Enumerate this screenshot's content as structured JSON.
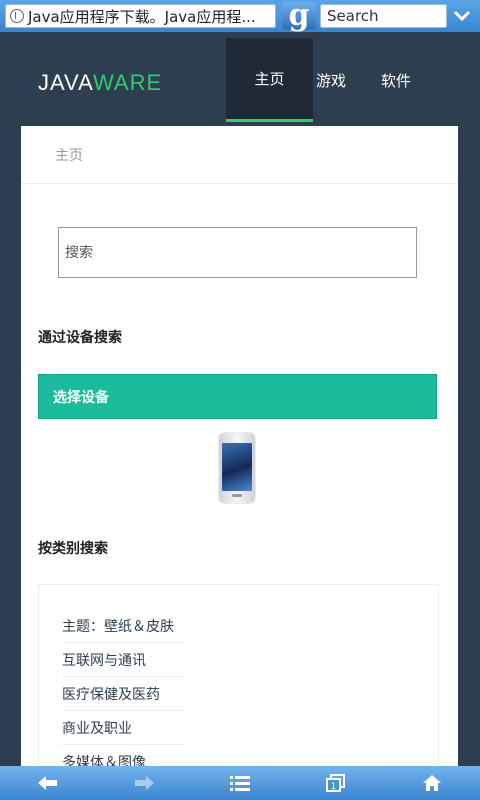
{
  "browser": {
    "url_text": "Java应用程序下载。Java应用程...",
    "search_placeholder": "Search",
    "search_engine_glyph": "g",
    "accent": "#3b85cf"
  },
  "site": {
    "brand_java": "JAVA",
    "brand_ware": "WARE",
    "nav": {
      "home": "主页",
      "games": "游戏",
      "software": "软件"
    },
    "colors": {
      "navbar": "#2c3e50",
      "brand_accent": "#2ecc71",
      "button": "#1abc9c"
    }
  },
  "page": {
    "breadcrumb": "主页",
    "search_placeholder": "搜索",
    "device_heading": "通过设备搜索",
    "device_button": "选择设备",
    "category_heading": "按类别搜索",
    "categories": [
      "主题：壁纸＆皮肤",
      "互联网与通讯",
      "医疗保健及医药",
      "商业及职业",
      "多媒体＆图像"
    ]
  },
  "toolbar": {
    "icons": [
      "back-arrow-icon",
      "forward-arrow-icon",
      "list-icon",
      "tabs-icon",
      "home-icon"
    ],
    "tab_count": "1"
  }
}
